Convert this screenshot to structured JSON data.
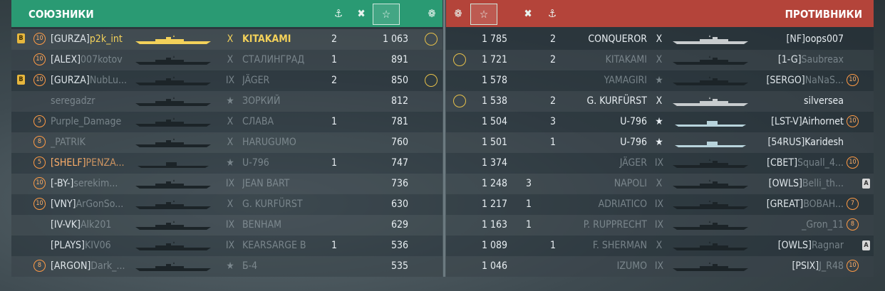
{
  "header": {
    "left_title": "СОЮЗНИКИ",
    "right_title": "ПРОТИВНИКИ",
    "icons": [
      "ship-damage-icon",
      "kills-icon",
      "star-icon",
      "medal-icon"
    ]
  },
  "allies": [
    {
      "div": "B",
      "level": "10",
      "clan": "[GURZA]",
      "name": "p2k_int",
      "tier": "X",
      "ship": "KITAKAMI",
      "kills": "2",
      "score": "1 063",
      "medal": true,
      "self": true,
      "alive": true
    },
    {
      "div": "",
      "level": "10",
      "clan": "[ALEX]",
      "name": "007kotov",
      "tier": "X",
      "ship": "СТАЛИНГРАД",
      "kills": "1",
      "score": "891",
      "medal": false,
      "alive": false
    },
    {
      "div": "B",
      "level": "10",
      "clan": "[GURZA]",
      "name": "NubLu...",
      "tier": "IX",
      "ship": "JÄGER",
      "kills": "2",
      "score": "850",
      "medal": true,
      "alive": false
    },
    {
      "div": "",
      "level": "",
      "clan": "",
      "name": "seregadzr",
      "tier": "★",
      "ship": "ЗОРКИЙ",
      "kills": "",
      "score": "812",
      "medal": false,
      "alive": false
    },
    {
      "div": "",
      "level": "5",
      "clan": "",
      "name": "Purple_Damage",
      "tier": "X",
      "ship": "СЛАВА",
      "kills": "1",
      "score": "781",
      "medal": false,
      "alive": false
    },
    {
      "div": "",
      "level": "8",
      "clan": "",
      "name": "_PATRIK",
      "tier": "X",
      "ship": "HARUGUMO",
      "kills": "",
      "score": "760",
      "medal": false,
      "alive": false
    },
    {
      "div": "",
      "level": "5",
      "clan": "[SHELF]",
      "name": "PENZA...",
      "tier": "★",
      "ship": "U-796",
      "kills": "1",
      "score": "747",
      "medal": false,
      "alive": false,
      "orange": true
    },
    {
      "div": "",
      "level": "10",
      "clan": "[-BY-]",
      "name": "serekim...",
      "tier": "IX",
      "ship": "JEAN BART",
      "kills": "",
      "score": "736",
      "medal": false,
      "alive": false
    },
    {
      "div": "",
      "level": "10",
      "clan": "[VNY]",
      "name": "ArGonSo...",
      "tier": "X",
      "ship": "G. KURFÜRST",
      "kills": "",
      "score": "630",
      "medal": false,
      "alive": false
    },
    {
      "div": "",
      "level": "",
      "clan": "[IV-VK]",
      "name": "Alk201",
      "tier": "IX",
      "ship": "BENHAM",
      "kills": "",
      "score": "629",
      "medal": false,
      "alive": false
    },
    {
      "div": "",
      "level": "",
      "clan": "[PLAYS]",
      "name": "KIV06",
      "tier": "IX",
      "ship": "KEARSARGE B",
      "kills": "1",
      "score": "536",
      "medal": false,
      "alive": false
    },
    {
      "div": "",
      "level": "8",
      "clan": "[ARGON]",
      "name": "Dark_...",
      "tier": "★",
      "ship": "Б-4",
      "kills": "",
      "score": "535",
      "medal": false,
      "alive": false
    }
  ],
  "enemies": [
    {
      "medal": false,
      "score": "1 785",
      "kills": "2",
      "ship": "CONQUEROR",
      "tier": "X",
      "clan": "[NF]",
      "name": "oops007",
      "level": "",
      "badge": "",
      "alive": true,
      "dark_ship": false
    },
    {
      "medal": true,
      "score": "1 721",
      "kills": "2",
      "ship": "KITAKAMI",
      "tier": "X",
      "clan": "[1-G]",
      "name": "Saubreax",
      "level": "",
      "badge": "",
      "alive": false
    },
    {
      "medal": false,
      "score": "1 578",
      "kills": "",
      "ship": "YAMAGIRI",
      "tier": "★",
      "clan": "[SERGO]",
      "name": "NaNaS...",
      "level": "10",
      "badge": "",
      "alive": false
    },
    {
      "medal": true,
      "score": "1 538",
      "kills": "2",
      "ship": "G. KURFÜRST",
      "tier": "X",
      "clan": "",
      "name": "silversea",
      "level": "",
      "badge": "",
      "alive": true
    },
    {
      "medal": false,
      "score": "1 504",
      "kills": "3",
      "ship": "U-796",
      "tier": "★",
      "clan": "[LST-V]",
      "name": "Airhornet",
      "level": "10",
      "badge": "",
      "alive": true,
      "sub": true
    },
    {
      "medal": false,
      "score": "1 501",
      "kills": "1",
      "ship": "U-796",
      "tier": "★",
      "clan": "[54RUS]",
      "name": "Karidesh",
      "level": "",
      "badge": "",
      "alive": true,
      "sub": true
    },
    {
      "medal": false,
      "score": "1 374",
      "kills": "",
      "ship": "JÄGER",
      "tier": "IX",
      "clan": "[CBET]",
      "name": "Squall_4...",
      "level": "10",
      "badge": "",
      "alive": false
    },
    {
      "medal": false,
      "score": "1 248",
      "kills": "3",
      "ship": "NAPOLI",
      "tier": "X",
      "clan": "[OWLS]",
      "name": "Belli_th...",
      "level": "",
      "badge": "A",
      "alive": false,
      "kills_col": "left"
    },
    {
      "medal": false,
      "score": "1 217",
      "kills": "1",
      "ship": "ADRIATICO",
      "tier": "IX",
      "clan": "[GREAT]",
      "name": "BOBAH...",
      "level": "7",
      "badge": "",
      "alive": false,
      "kills_col": "left"
    },
    {
      "medal": false,
      "score": "1 163",
      "kills": "1",
      "ship": "P. RUPPRECHT",
      "tier": "IX",
      "clan": "",
      "name": "_Gron_11",
      "level": "8",
      "badge": "",
      "alive": false,
      "kills_col": "left"
    },
    {
      "medal": false,
      "score": "1 089",
      "kills": "1",
      "ship": "F. SHERMAN",
      "tier": "X",
      "clan": "[OWLS]",
      "name": "Ragnar",
      "level": "",
      "badge": "A",
      "alive": false
    },
    {
      "medal": false,
      "score": "1 046",
      "kills": "",
      "ship": "IZUMO",
      "tier": "IX",
      "clan": "[PSIX]",
      "name": "J_R48",
      "level": "10",
      "badge": "",
      "alive": false
    }
  ],
  "colors": {
    "ally_header": "#2a9a73",
    "enemy_header": "#b4443a",
    "self_name": "#f3d15a",
    "division": "#ffb06a"
  }
}
